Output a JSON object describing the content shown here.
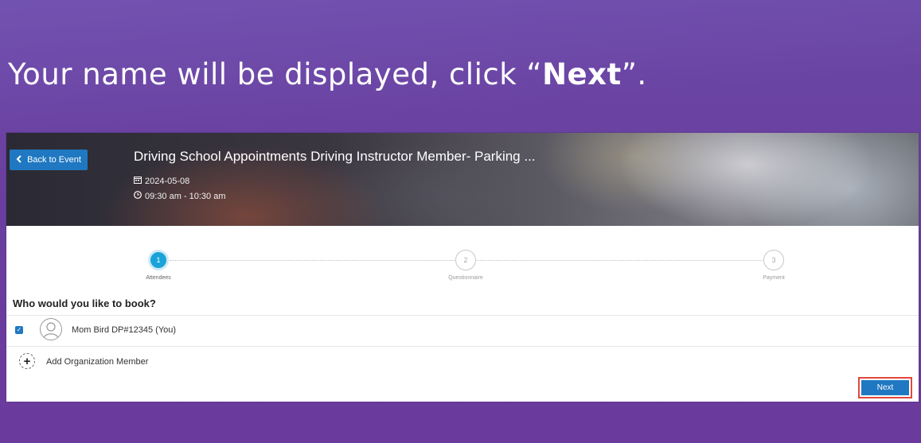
{
  "slide": {
    "instruction_prefix": "Your name will be displayed, click “",
    "instruction_bold": "Next",
    "instruction_suffix": "”."
  },
  "header": {
    "back_label": "Back to Event",
    "event_title": "Driving School Appointments Driving Instructor Member- Parking ...",
    "date": "2024-05-08",
    "time": "09:30 am - 10:30 am"
  },
  "stepper": {
    "steps": [
      {
        "number": "1",
        "label": "Attendees",
        "state": "active"
      },
      {
        "number": "2",
        "label": "Questionnaire",
        "state": "todo"
      },
      {
        "number": "3",
        "label": "Payment",
        "state": "todo"
      }
    ]
  },
  "booking": {
    "question": "Who would you like to book?",
    "member_name": "Mom Bird DP#12345 (You)",
    "member_checked": true,
    "add_member_label": "Add Organization Member",
    "next_label": "Next"
  },
  "colors": {
    "slide_background": "#6a3fa0",
    "primary_button": "#1f78c1",
    "active_step": "#1aa3d9",
    "highlight_box": "#e0483e"
  }
}
